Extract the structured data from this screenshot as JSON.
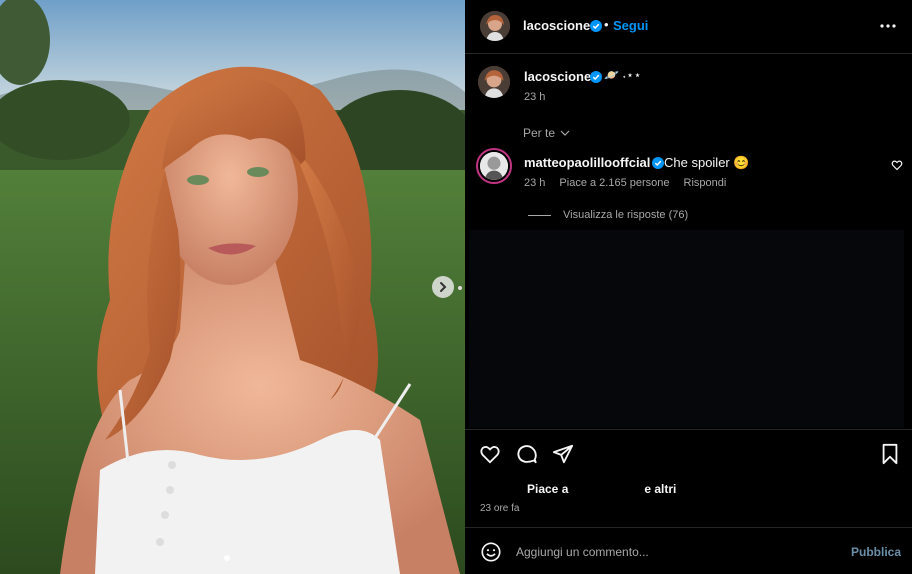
{
  "post": {
    "author": "lacoscione",
    "follow_label": "Segui",
    "separator": "•",
    "caption_emojis": "🪐 ˖⋆⋆",
    "caption_time": "23 h",
    "more_icon": "more-horizontal-icon"
  },
  "comments_filter": "Per te",
  "comment": {
    "username": "matteopaolillooffcial",
    "text": "Che spoiler 😊",
    "time": "23 h",
    "likes": "Piace a 2.165 persone",
    "reply_label": "Rispondi",
    "view_replies": "Visualizza le risposte (76)"
  },
  "actions": {
    "like_prefix": "Piace a",
    "like_suffix": "e altri",
    "date": "23 ore fa"
  },
  "composer": {
    "placeholder": "Aggiungi un commento...",
    "publish_label": "Pubblica"
  },
  "colors": {
    "background": "#000000",
    "accent_blue": "#0095f6",
    "muted_text": "#a8a8a8",
    "divider": "#262626"
  }
}
